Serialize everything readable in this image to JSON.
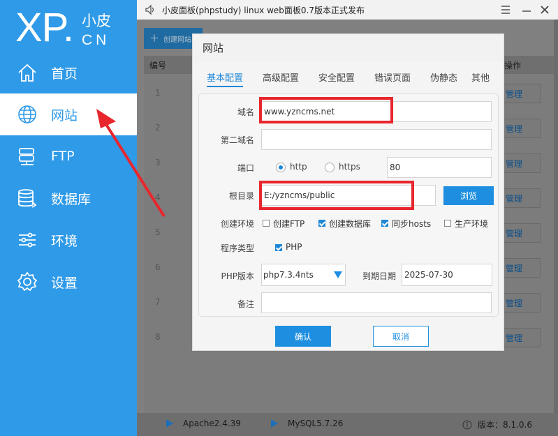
{
  "logo": {
    "xp": "XP",
    "dot": ".",
    "cn_zh": "小皮",
    "cn_en": "CN"
  },
  "sidebar": {
    "items": [
      {
        "label": "首页",
        "icon": "home-icon"
      },
      {
        "label": "网站",
        "icon": "globe-icon",
        "active": true
      },
      {
        "label": "FTP",
        "icon": "server-icon"
      },
      {
        "label": "数据库",
        "icon": "database-icon"
      },
      {
        "label": "环境",
        "icon": "sliders-icon"
      },
      {
        "label": "设置",
        "icon": "gear-icon"
      }
    ]
  },
  "window": {
    "title": "小皮面板(phpstudy) linux web面板0.7版本正式发布",
    "minimize": "—",
    "close": "✕"
  },
  "background": {
    "create_label": "创建网站",
    "col_id": "编号",
    "col_op": "操作",
    "rows": [
      {
        "num": "1",
        "btn": "管理"
      },
      {
        "num": "2",
        "btn": "管理"
      },
      {
        "num": "3",
        "btn": "管理"
      },
      {
        "num": "4",
        "btn": "管理"
      },
      {
        "num": "5",
        "btn": "管理"
      },
      {
        "num": "6",
        "btn": "管理"
      },
      {
        "num": "7",
        "btn": "管理"
      },
      {
        "num": "8",
        "btn": "管理"
      }
    ]
  },
  "status": {
    "apache": "Apache2.4.39",
    "mysql": "MySQL5.7.26",
    "version": "版本：8.1.0.6"
  },
  "dialog": {
    "title": "网站",
    "tabs": [
      "基本配置",
      "高级配置",
      "安全配置",
      "错误页面",
      "伪静态",
      "其他"
    ],
    "domain_label": "域名",
    "domain_value": "www.yzncms.net",
    "domain2_label": "第二域名",
    "domain2_value": "",
    "port_label": "端口",
    "http_label": "http",
    "https_label": "https",
    "port_value": "80",
    "root_label": "根目录",
    "root_value": "E:/yzncms/public",
    "browse_label": "浏览",
    "env_label": "创建环境",
    "env_options": [
      {
        "label": "创建FTP",
        "checked": false
      },
      {
        "label": "创建数据库",
        "checked": true
      },
      {
        "label": "同步hosts",
        "checked": true
      },
      {
        "label": "生产环境",
        "checked": false
      }
    ],
    "prog_label": "程序类型",
    "prog_option": {
      "label": "PHP",
      "checked": true
    },
    "php_label": "PHP版本",
    "php_value": "php7.3.4nts",
    "expire_label": "到期日期",
    "expire_value": "2025-07-30",
    "note_label": "备注",
    "note_value": "",
    "ok_label": "确认",
    "cancel_label": "取消"
  },
  "colors": {
    "brand": "#2f9ae8",
    "button": "#1e8fe0",
    "annotation": "#e8262d"
  }
}
